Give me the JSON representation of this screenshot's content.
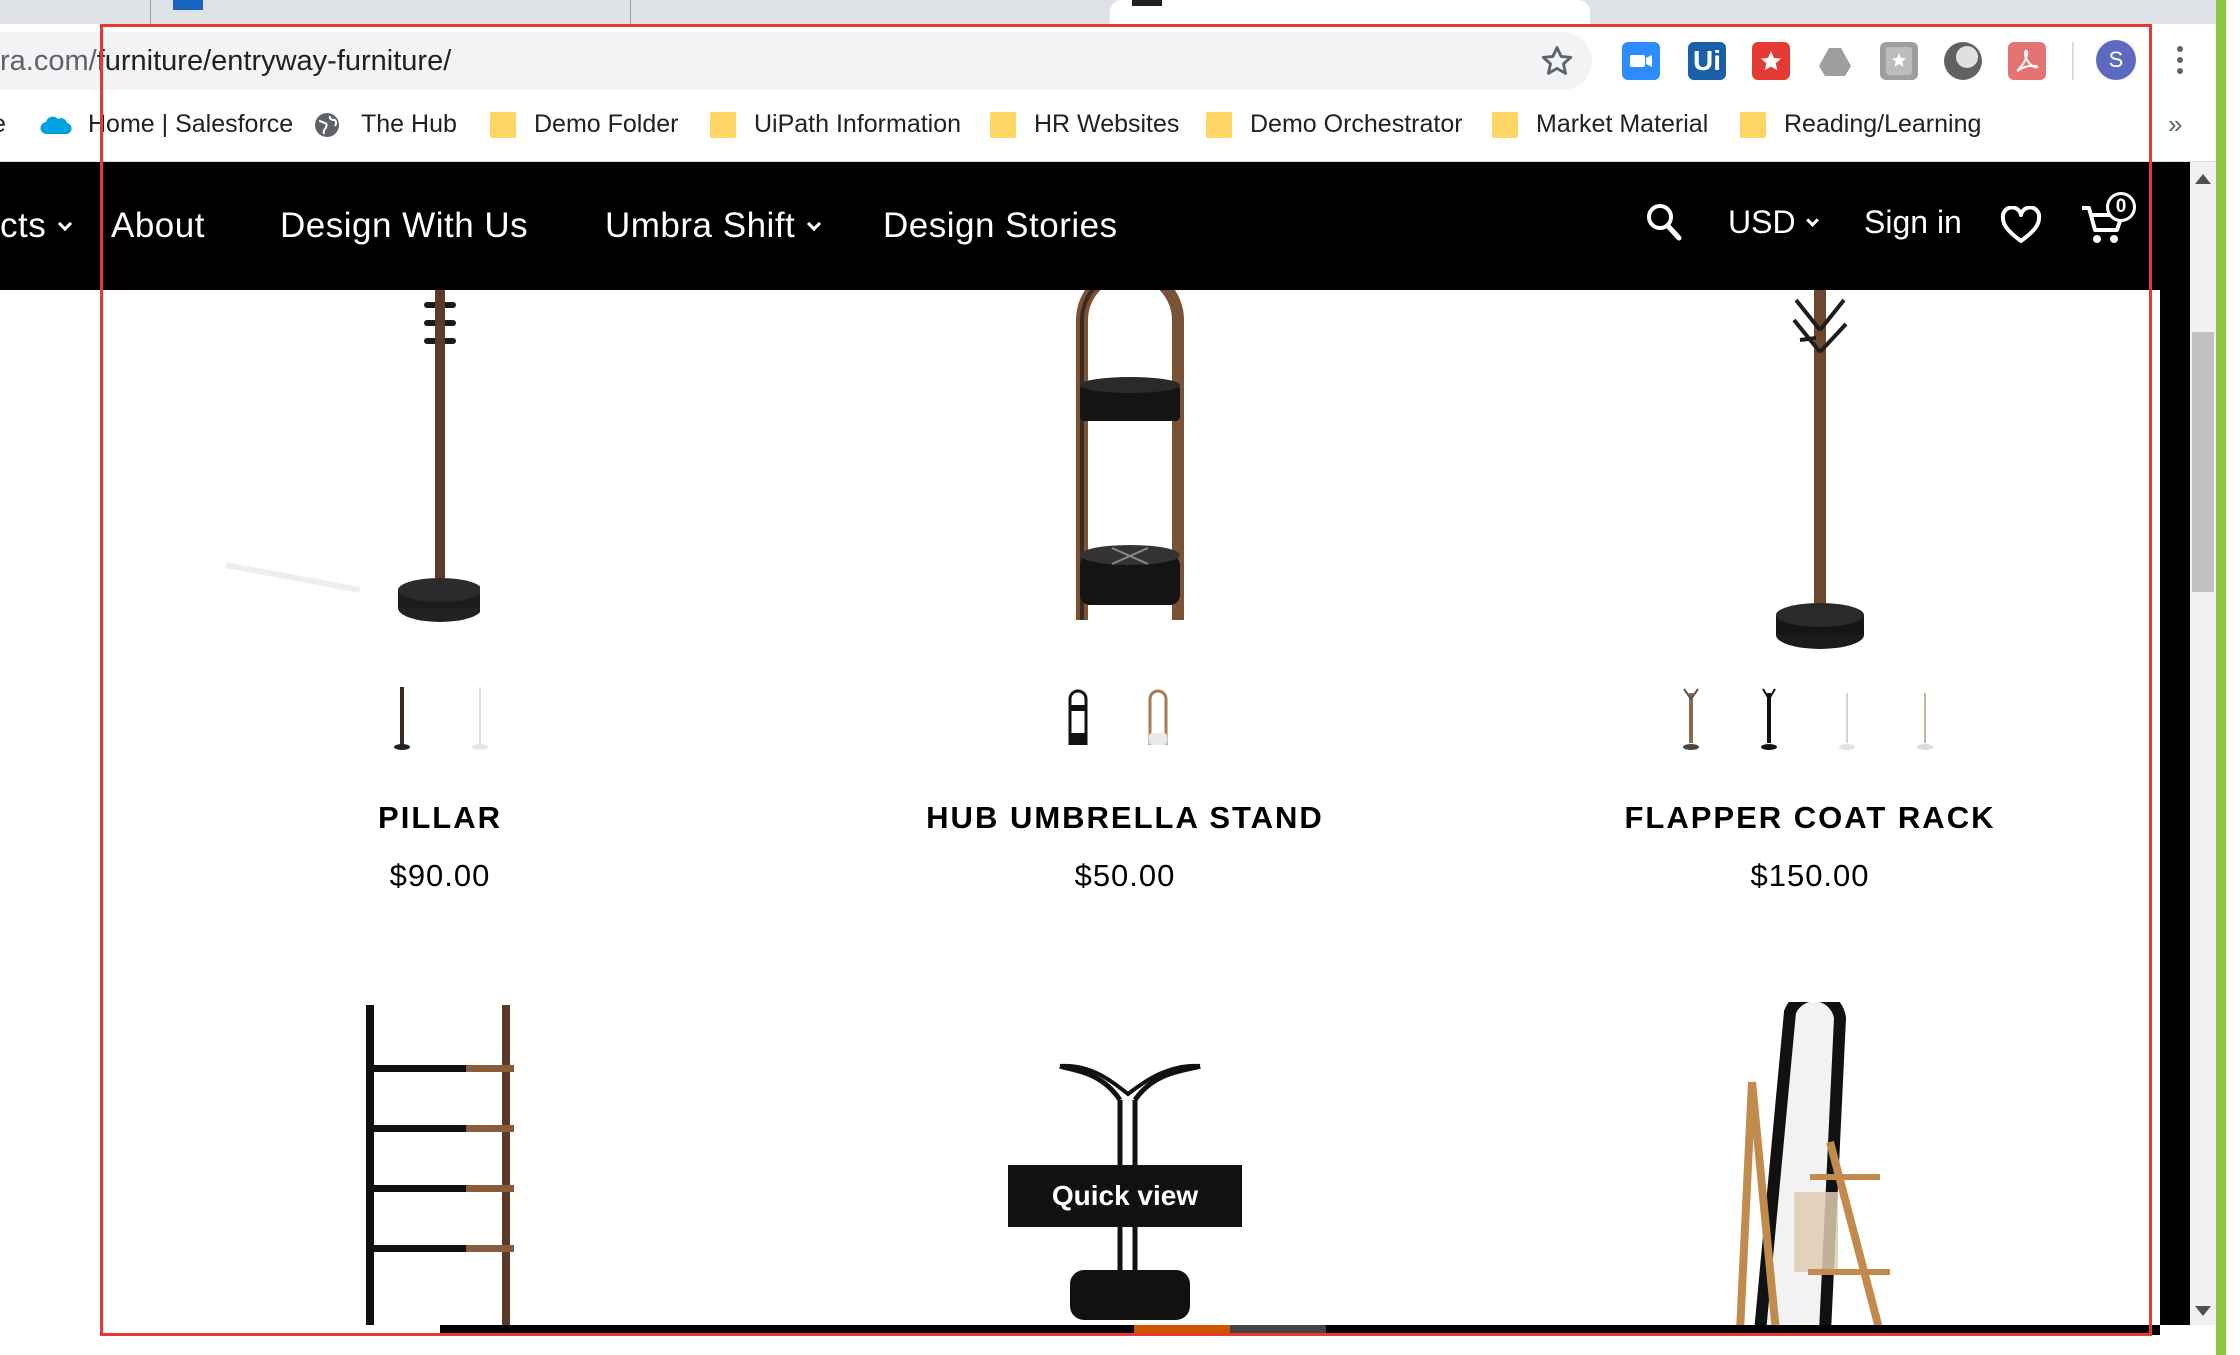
{
  "browser": {
    "url_prefix": "ra.com/",
    "url_path": "furniture/entryway-furniture/",
    "avatar_letter": "S",
    "ext_ui_label": "Ui",
    "more_bookmarks": "»"
  },
  "bookmarks": [
    {
      "label": "Home | Salesforce",
      "icon": "salesforce-cloud-icon"
    },
    {
      "label": "The Hub",
      "icon": "globe-icon"
    },
    {
      "label": "Demo Folder",
      "icon": "folder-icon"
    },
    {
      "label": "UiPath Information",
      "icon": "folder-icon"
    },
    {
      "label": "HR Websites",
      "icon": "folder-icon"
    },
    {
      "label": "Demo Orchestrator",
      "icon": "folder-icon"
    },
    {
      "label": "Market Material",
      "icon": "folder-icon"
    },
    {
      "label": "Reading/Learning",
      "icon": "folder-icon"
    }
  ],
  "nav": {
    "products_partial": "cts",
    "about": "About",
    "design_with_us": "Design With Us",
    "umbra_shift": "Umbra Shift",
    "design_stories": "Design Stories",
    "currency": "USD",
    "sign_in": "Sign in",
    "cart_count": "0"
  },
  "products": [
    {
      "name": "PILLAR",
      "price": "$90.00"
    },
    {
      "name": "HUB UMBRELLA STAND",
      "price": "$50.00"
    },
    {
      "name": "FLAPPER COAT RACK",
      "price": "$150.00"
    }
  ],
  "quick_view": "Quick view",
  "colors": {
    "nav_bg": "#000000",
    "accent_green": "#8dc63f",
    "frame_red": "#e53935",
    "walnut": "#5b3a29"
  }
}
